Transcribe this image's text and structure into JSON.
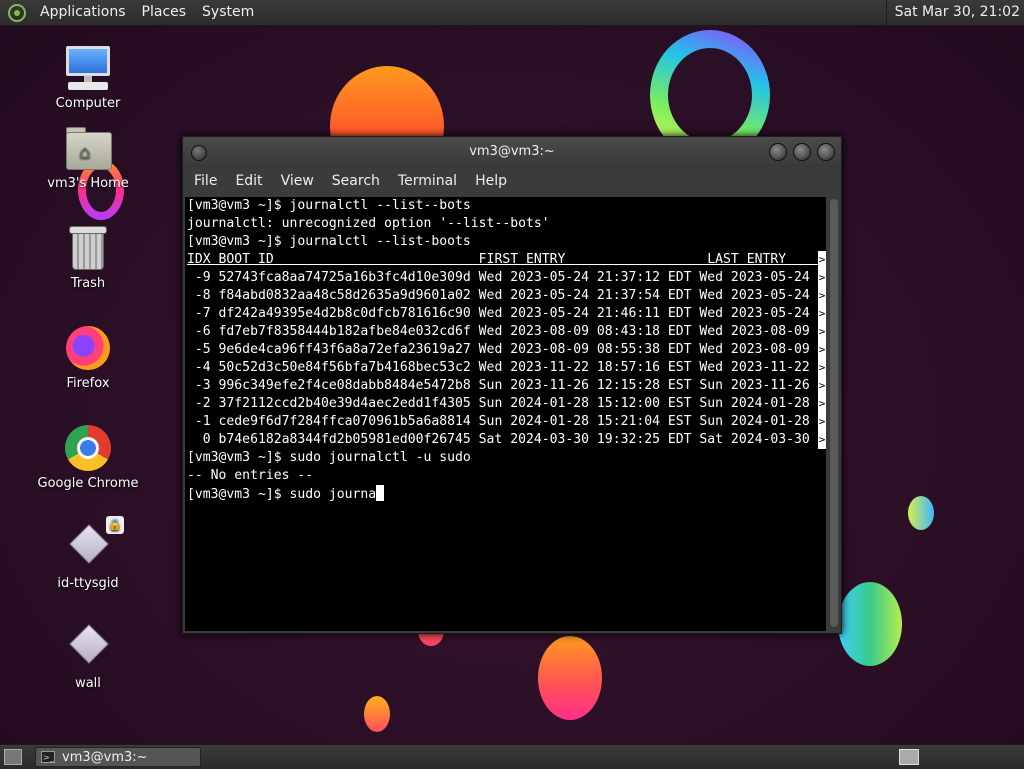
{
  "top_panel": {
    "menus": [
      "Applications",
      "Places",
      "System"
    ],
    "clock": "Sat Mar 30, 21:02"
  },
  "desktop_icons": [
    {
      "label": "Computer",
      "icon": "computer-icon"
    },
    {
      "label": "vm3's Home",
      "icon": "home-folder-icon"
    },
    {
      "label": "Trash",
      "icon": "trash-icon"
    },
    {
      "label": "Firefox",
      "icon": "firefox-icon"
    },
    {
      "label": "Google Chrome",
      "icon": "chrome-icon"
    },
    {
      "label": "id-ttysgid",
      "icon": "file-icon"
    },
    {
      "label": "wall",
      "icon": "file-icon"
    }
  ],
  "terminal": {
    "title": "vm3@vm3:~",
    "menu": [
      "File",
      "Edit",
      "View",
      "Search",
      "Terminal",
      "Help"
    ],
    "lines": [
      "[vm3@vm3 ~]$ journalctl --list--bots",
      "journalctl: unrecognized option '--list--bots'",
      "[vm3@vm3 ~]$ journalctl --list-boots"
    ],
    "boot_header": "IDX BOOT ID                          FIRST ENTRY                  LAST ENTRY     ",
    "boots": [
      " -9 52743fca8aa74725a16b3fc4d10e309d Wed 2023-05-24 21:37:12 EDT Wed 2023-05-24",
      " -8 f84abd0832aa48c58d2635a9d9601a02 Wed 2023-05-24 21:37:54 EDT Wed 2023-05-24",
      " -7 df242a49395e4d2b8c0dfcb781616c90 Wed 2023-05-24 21:46:11 EDT Wed 2023-05-24",
      " -6 fd7eb7f8358444b182afbe84e032cd6f Wed 2023-08-09 08:43:18 EDT Wed 2023-08-09",
      " -5 9e6de4ca96ff43f6a8a72efa23619a27 Wed 2023-08-09 08:55:38 EDT Wed 2023-08-09",
      " -4 50c52d3c50e84f56bfa7b4168bec53c2 Wed 2023-11-22 18:57:16 EST Wed 2023-11-22",
      " -3 996c349efe2f4ce08dabb8484e5472b8 Sun 2023-11-26 12:15:28 EST Sun 2023-11-26",
      " -2 37f2112ccd2b40e39d4aec2edd1f4305 Sun 2024-01-28 15:12:00 EST Sun 2024-01-28",
      " -1 cede9f6d7f284ffca070961b5a6a8814 Sun 2024-01-28 15:21:04 EST Sun 2024-01-28",
      "  0 b74e6182a8344fd2b05981ed00f26745 Sat 2024-03-30 19:32:25 EDT Sat 2024-03-30"
    ],
    "after_lines": [
      "[vm3@vm3 ~]$ sudo journalctl -u sudo",
      "-- No entries --"
    ],
    "prompt_line": "[vm3@vm3 ~]$ sudo journa",
    "overflow_marker": ">"
  },
  "bottom_panel": {
    "task_label": "vm3@vm3:~"
  }
}
